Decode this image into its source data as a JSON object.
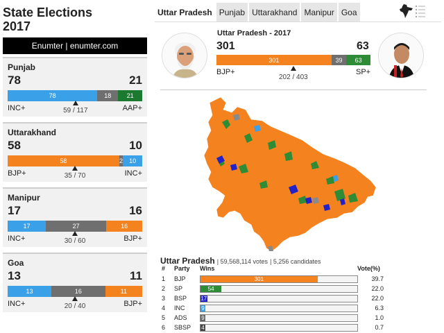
{
  "title_line1": "State Elections",
  "title_line2": "2017",
  "brand": "Enumter | enumter.com",
  "colors": {
    "bjp": "#f4821f",
    "inc": "#3aa0e8",
    "other": "#6f6f6f",
    "aap": "#1b7a2f",
    "sp": "#2e8b36",
    "bsp": "#2222c8",
    "ads": "#666666",
    "sbsp": "#444444"
  },
  "states": [
    {
      "name": "Punjab",
      "left_seats": "78",
      "right_seats": "21",
      "left_party": "INC+",
      "right_party": "AAP+",
      "majority": "59 / 117",
      "segments": [
        {
          "label": "78",
          "value": 78,
          "color": "#3aa0e8"
        },
        {
          "label": "18",
          "value": 18,
          "color": "#6f6f6f"
        },
        {
          "label": "21",
          "value": 21,
          "color": "#1b7a2f"
        }
      ],
      "total": 117,
      "majority_value": 59
    },
    {
      "name": "Uttarakhand",
      "left_seats": "58",
      "right_seats": "10",
      "left_party": "BJP+",
      "right_party": "INC+",
      "majority": "35 / 70",
      "segments": [
        {
          "label": "58",
          "value": 58,
          "color": "#f4821f"
        },
        {
          "label": "2",
          "value": 2,
          "color": "#6f6f6f"
        },
        {
          "label": "10",
          "value": 10,
          "color": "#3aa0e8"
        }
      ],
      "total": 70,
      "majority_value": 35
    },
    {
      "name": "Manipur",
      "left_seats": "17",
      "right_seats": "16",
      "left_party": "INC+",
      "right_party": "BJP+",
      "majority": "30 / 60",
      "segments": [
        {
          "label": "17",
          "value": 17,
          "color": "#3aa0e8"
        },
        {
          "label": "27",
          "value": 27,
          "color": "#6f6f6f"
        },
        {
          "label": "16",
          "value": 16,
          "color": "#f4821f"
        }
      ],
      "total": 60,
      "majority_value": 30
    },
    {
      "name": "Goa",
      "left_seats": "13",
      "right_seats": "11",
      "left_party": "INC+",
      "right_party": "BJP+",
      "majority": "20 / 40",
      "segments": [
        {
          "label": "13",
          "value": 13,
          "color": "#3aa0e8"
        },
        {
          "label": "16",
          "value": 16,
          "color": "#6f6f6f"
        },
        {
          "label": "11",
          "value": 11,
          "color": "#f4821f"
        }
      ],
      "total": 40,
      "majority_value": 20
    }
  ],
  "tabs": [
    "Uttar Pradesh",
    "Punjab",
    "Uttarakhand",
    "Manipur",
    "Goa"
  ],
  "active_tab": 0,
  "icons": {
    "map": "india-map-icon",
    "menu": "list-menu-icon",
    "left_avatar": "bjp-leader-avatar",
    "right_avatar": "sp-leader-avatar"
  },
  "header": {
    "title": "Uttar Pradesh - 2017",
    "left_seats": "301",
    "right_seats": "63",
    "left_party": "BJP+",
    "right_party": "SP+",
    "majority": "202 / 403",
    "segments": [
      {
        "label": "301",
        "value": 301,
        "color": "#f4821f"
      },
      {
        "label": "39",
        "value": 39,
        "color": "#6f6f6f"
      },
      {
        "label": "63",
        "value": 63,
        "color": "#2e8b36"
      }
    ],
    "total": 403
  },
  "results": {
    "state": "Uttar Pradesh",
    "votes": "59,568,114 votes",
    "candidates": "5,256 candidates",
    "columns": {
      "num": "#",
      "party": "Party",
      "wins": "Wins",
      "vote": "Vote(%)"
    },
    "max": 403,
    "rows": [
      {
        "num": "1",
        "party": "BJP",
        "wins": 301,
        "wins_label": "301",
        "vote": "39.7",
        "color": "#f4821f"
      },
      {
        "num": "2",
        "party": "SP",
        "wins": 54,
        "wins_label": "54",
        "vote": "22.0",
        "color": "#2e8b36"
      },
      {
        "num": "3",
        "party": "BSP",
        "wins": 17,
        "wins_label": "17",
        "vote": "22.0",
        "color": "#2222c8"
      },
      {
        "num": "4",
        "party": "INC",
        "wins": 9,
        "wins_label": "9",
        "vote": "6.3",
        "color": "#3aa0e8"
      },
      {
        "num": "5",
        "party": "ADS",
        "wins": 9,
        "wins_label": "9",
        "vote": "1.0",
        "color": "#666666"
      },
      {
        "num": "6",
        "party": "SBSP",
        "wins": 4,
        "wins_label": "4",
        "vote": "0.7",
        "color": "#444444"
      }
    ]
  }
}
